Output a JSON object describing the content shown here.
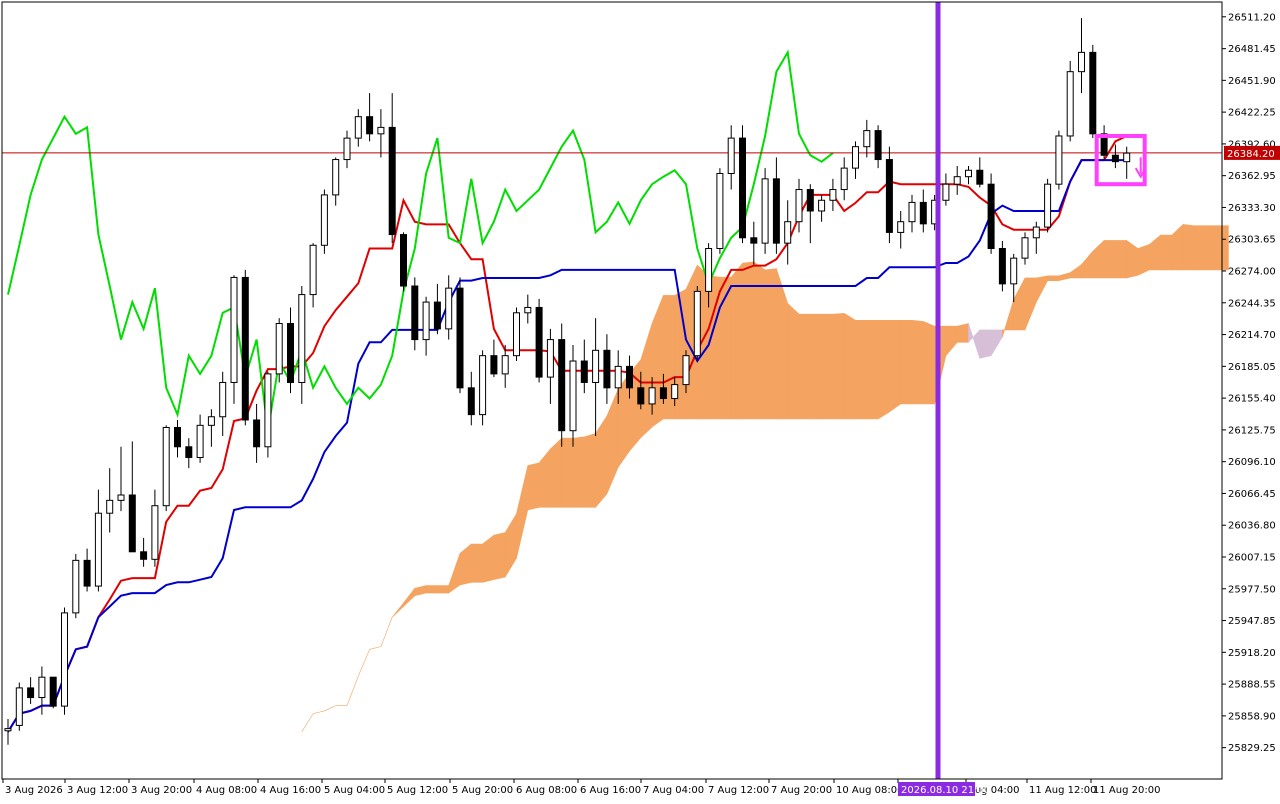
{
  "chart_data": {
    "type": "candlestick",
    "y_axis": {
      "position": "right",
      "ylim": [
        25800,
        26525
      ],
      "ticks": [
        "26511.20",
        "26481.45",
        "26451.90",
        "26422.25",
        "26392.60",
        "26362.95",
        "26333.30",
        "26303.65",
        "26274.00",
        "26244.35",
        "26214.70",
        "26185.05",
        "26155.40",
        "26125.75",
        "26096.10",
        "26066.45",
        "26036.80",
        "26007.15",
        "25977.50",
        "25947.85",
        "25918.20",
        "25888.55",
        "25858.90",
        "25829.25"
      ]
    },
    "x_axis": {
      "tick_labels": [
        "3 Aug 2026",
        "3 Aug 12:00",
        "3 Aug 20:00",
        "4 Aug 08:00",
        "4 Aug 16:00",
        "5 Aug 04:00",
        "5 Aug 12:00",
        "5 Aug 20:00",
        "6 Aug 08:00",
        "6 Aug 16:00",
        "7 Aug 04:00",
        "7 Aug 12:00",
        "7 Aug 20:00",
        "10 Aug 08:00",
        "",
        "Aug 04:00",
        "11 Aug 12:00",
        "11 Aug 20:00"
      ],
      "highlight_label": "2026.08.10 21:00"
    },
    "bid_line": {
      "value": 26384.2,
      "label": "26384.20"
    },
    "colors": {
      "tenkan": "#e00000",
      "kijun": "#0000cc",
      "chikou": "#00dd00",
      "kumo": "#f4a460",
      "kumo_alt": "#d8bfd8",
      "vertical_marker": "#8a2be2",
      "annotation": "#ff40ff",
      "bull_candle": "#ffffff",
      "bear_candle": "#000000",
      "bid_line": "#c00000"
    },
    "series": [
      {
        "name": "",
        "kind": "ohlc",
        "values": [
          [
            25845,
            25856,
            25832,
            25847
          ],
          [
            25850,
            25890,
            25845,
            25885
          ],
          [
            25885,
            25895,
            25870,
            25876
          ],
          [
            25876,
            25905,
            25860,
            25895
          ],
          [
            25895,
            25880,
            25866,
            25868
          ],
          [
            25868,
            25960,
            25860,
            25955
          ],
          [
            25955,
            26010,
            25950,
            26004
          ],
          [
            26004,
            26015,
            25975,
            25980
          ],
          [
            25980,
            26070,
            25975,
            26048
          ],
          [
            26048,
            26090,
            26030,
            26060
          ],
          [
            26060,
            26110,
            26050,
            26065
          ],
          [
            26065,
            26115,
            26050,
            26012
          ],
          [
            26012,
            26025,
            25998,
            26005
          ],
          [
            26005,
            26070,
            25998,
            26055
          ],
          [
            26055,
            26130,
            26050,
            26128
          ],
          [
            26128,
            26135,
            26100,
            26110
          ],
          [
            26110,
            26118,
            26090,
            26100
          ],
          [
            26100,
            26140,
            26095,
            26130
          ],
          [
            26130,
            26145,
            26110,
            26138
          ],
          [
            26138,
            26180,
            26120,
            26170
          ],
          [
            26170,
            26270,
            26150,
            26268
          ],
          [
            26268,
            26275,
            26130,
            26135
          ],
          [
            26135,
            26150,
            26095,
            26110
          ],
          [
            26110,
            26180,
            26100,
            26178
          ],
          [
            26178,
            26230,
            26170,
            26225
          ],
          [
            26225,
            26240,
            26160,
            26170
          ],
          [
            26170,
            26260,
            26150,
            26252
          ],
          [
            26252,
            26300,
            26240,
            26298
          ],
          [
            26298,
            26350,
            26290,
            26345
          ],
          [
            26345,
            26380,
            26335,
            26378
          ],
          [
            26378,
            26405,
            26370,
            26398
          ],
          [
            26398,
            26425,
            26390,
            26418
          ],
          [
            26418,
            26440,
            26395,
            26402
          ],
          [
            26402,
            26425,
            26380,
            26408
          ],
          [
            26408,
            26440,
            26300,
            26308
          ],
          [
            26308,
            26310,
            26255,
            26260
          ],
          [
            26260,
            26268,
            26200,
            26210
          ],
          [
            26210,
            26250,
            26195,
            26245
          ],
          [
            26245,
            26262,
            26215,
            26220
          ],
          [
            26220,
            26270,
            26210,
            26258
          ],
          [
            26258,
            26268,
            26160,
            26165
          ],
          [
            26165,
            26180,
            26130,
            26140
          ],
          [
            26140,
            26200,
            26130,
            26195
          ],
          [
            26195,
            26210,
            26175,
            26178
          ],
          [
            26178,
            26205,
            26165,
            26195
          ],
          [
            26195,
            26240,
            26190,
            26235
          ],
          [
            26235,
            26252,
            26225,
            26240
          ],
          [
            26240,
            26248,
            26170,
            26175
          ],
          [
            26175,
            26220,
            26150,
            26210
          ],
          [
            26210,
            26225,
            26110,
            26125
          ],
          [
            26125,
            26205,
            26110,
            26190
          ],
          [
            26190,
            26210,
            26160,
            26170
          ],
          [
            26170,
            26230,
            26120,
            26200
          ],
          [
            26200,
            26215,
            26150,
            26165
          ],
          [
            26165,
            26200,
            26150,
            26185
          ],
          [
            26185,
            26195,
            26155,
            26165
          ],
          [
            26165,
            26180,
            26145,
            26150
          ],
          [
            26150,
            26175,
            26140,
            26165
          ],
          [
            26165,
            26178,
            26150,
            26155
          ],
          [
            26155,
            26175,
            26148,
            26168
          ],
          [
            26168,
            26200,
            26160,
            26195
          ],
          [
            26195,
            26260,
            26190,
            26255
          ],
          [
            26255,
            26300,
            26240,
            26295
          ],
          [
            26295,
            26370,
            26290,
            26365
          ],
          [
            26365,
            26410,
            26350,
            26398
          ],
          [
            26398,
            26410,
            26300,
            26305
          ],
          [
            26305,
            26320,
            26280,
            26300
          ],
          [
            26300,
            26370,
            26290,
            26360
          ],
          [
            26360,
            26380,
            26290,
            26300
          ],
          [
            26300,
            26340,
            26280,
            26320
          ],
          [
            26320,
            26360,
            26310,
            26350
          ],
          [
            26350,
            26355,
            26300,
            26330
          ],
          [
            26330,
            26345,
            26320,
            26340
          ],
          [
            26340,
            26360,
            26330,
            26350
          ],
          [
            26350,
            26380,
            26340,
            26370
          ],
          [
            26370,
            26395,
            26360,
            26390
          ],
          [
            26390,
            26415,
            26380,
            26405
          ],
          [
            26405,
            26410,
            26370,
            26378
          ],
          [
            26378,
            26390,
            26300,
            26310
          ],
          [
            26310,
            26330,
            26295,
            26320
          ],
          [
            26320,
            26345,
            26310,
            26338
          ],
          [
            26338,
            26350,
            26310,
            26318
          ],
          [
            26318,
            26345,
            26312,
            26340
          ],
          [
            26340,
            26365,
            26335,
            26355
          ],
          [
            26355,
            26372,
            26345,
            26362
          ],
          [
            26362,
            26372,
            26355,
            26368
          ],
          [
            26368,
            26380,
            26352,
            26355
          ],
          [
            26355,
            26365,
            26290,
            26295
          ],
          [
            26295,
            26302,
            26255,
            26262
          ],
          [
            26262,
            26290,
            26245,
            26286
          ],
          [
            26286,
            26310,
            26280,
            26305
          ],
          [
            26305,
            26320,
            26290,
            26315
          ],
          [
            26315,
            26360,
            26310,
            26355
          ],
          [
            26355,
            26405,
            26350,
            26400
          ],
          [
            26400,
            26470,
            26395,
            26460
          ],
          [
            26460,
            26510,
            26440,
            26478
          ],
          [
            26478,
            26485,
            26398,
            26402
          ],
          [
            26402,
            26410,
            26378,
            26382
          ],
          [
            26382,
            26392,
            26370,
            26376
          ],
          [
            26376,
            26390,
            26360,
            26384
          ]
        ]
      },
      {
        "name": "",
        "kind": "tenkan-sen"
      },
      {
        "name": "",
        "kind": "kijun-sen"
      },
      {
        "name": "",
        "kind": "chikou-span"
      },
      {
        "name": "",
        "kind": "kumo"
      }
    ],
    "grid": false,
    "vertical_marker_time": "2026.08.10 21:00",
    "annotation": "signal box with down arrow near last candles"
  }
}
